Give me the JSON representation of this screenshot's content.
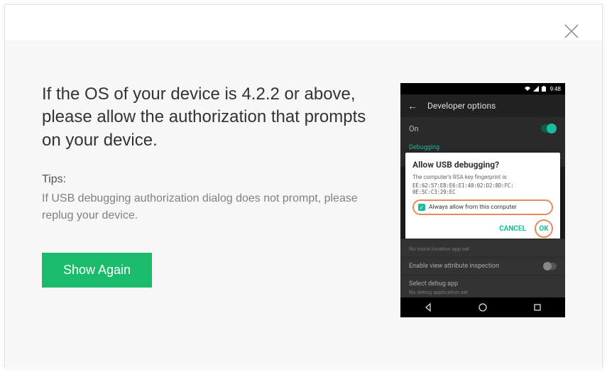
{
  "close_icon_name": "close-icon",
  "main": {
    "heading": "If the OS of your device is 4.2.2 or above, please allow the authorization that prompts on your device.",
    "tips_label": "Tips:",
    "tips_body": "If USB debugging authorization dialog does not prompt, please replug your device.",
    "button_label": "Show Again"
  },
  "phone": {
    "status_time": "9:48",
    "appbar_title": "Developer options",
    "on_label": "On",
    "section_label": "Debugging",
    "popup": {
      "title": "Allow USB debugging?",
      "subtitle": "The computer's RSA key fingerprint is:",
      "fingerprint_l1": "EE:62:57:E8:E6:E1:48:02:D2:8D:FC:",
      "fingerprint_l2": "0E:5C:C3:29:EC",
      "checkbox_label": "Always allow from this computer",
      "cancel": "CANCEL",
      "ok": "OK"
    },
    "rows": {
      "mock_sub": "No mock location app set",
      "attr_inspect": "Enable view attribute inspection",
      "select_debug": "Select debug app",
      "select_debug_sub": "No debug application set"
    }
  }
}
